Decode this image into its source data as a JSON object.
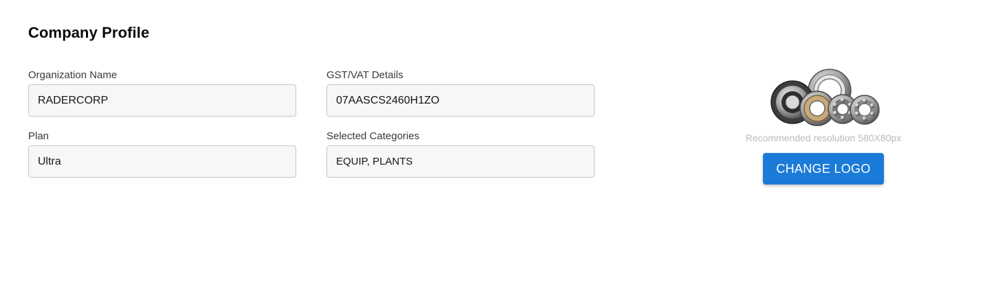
{
  "page": {
    "title": "Company Profile"
  },
  "form": {
    "organization_name": {
      "label": "Organization Name",
      "value": "RADERCORP"
    },
    "gst_vat": {
      "label": "GST/VAT Details",
      "value": "07AASCS2460H1ZO"
    },
    "plan": {
      "label": "Plan",
      "value": "Ultra"
    },
    "categories": {
      "label": "Selected Categories",
      "value": "EQUIP, PLANTS"
    }
  },
  "logo": {
    "image": "ball-bearings-logo",
    "hint": "Recommended resolution 580X80px",
    "button_label": "CHANGE LOGO"
  },
  "colors": {
    "accent": "#1b7bd8",
    "input_background": "#f7f7f7",
    "input_border": "#c6c6c6",
    "hint_text": "#b9b9b9"
  }
}
